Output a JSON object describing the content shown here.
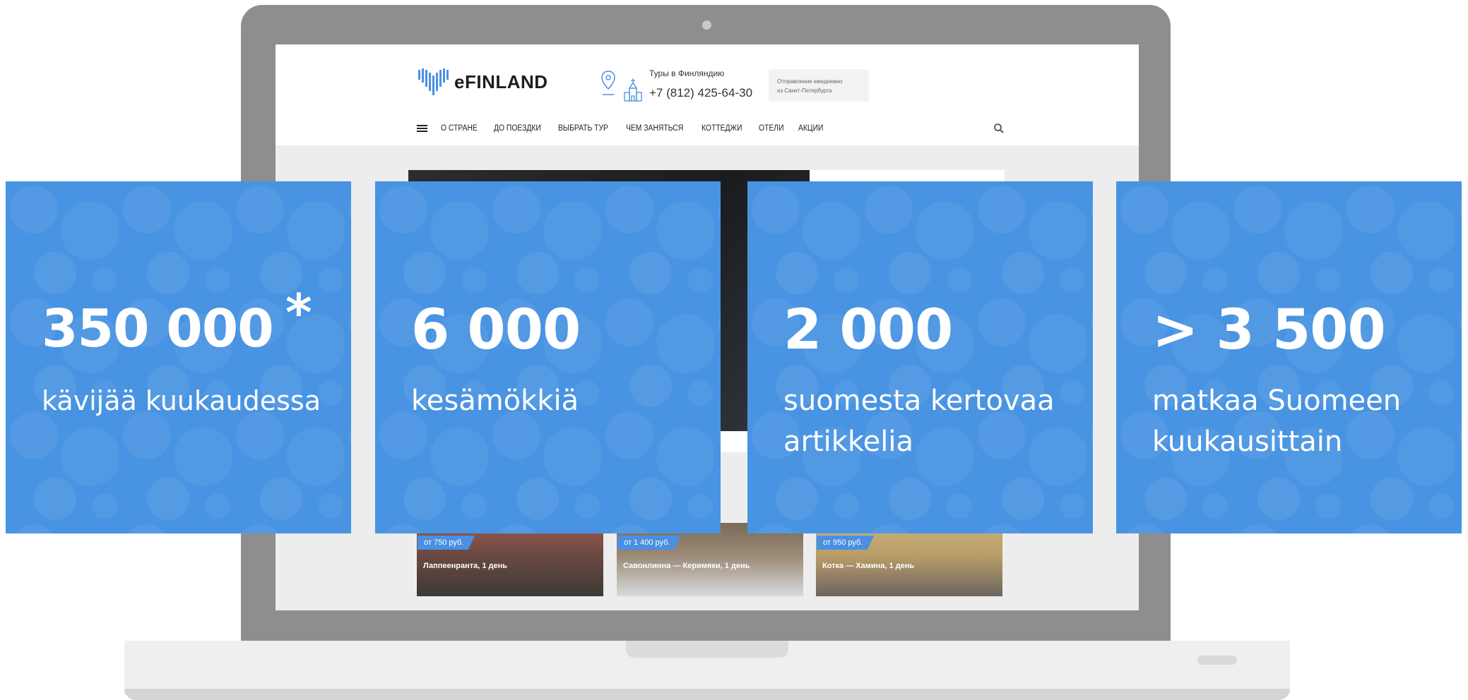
{
  "site": {
    "brand": "eFINLAND",
    "tours_label": "Туры в Финляндию",
    "phone": "+7 (812) 425-64-30",
    "departure_line1": "Отправление ежедневно",
    "departure_line2": "из Санкт-Петербурга",
    "nav": [
      "О СТРАНЕ",
      "ДО ПОЕЗДКИ",
      "ВЫБРАТЬ ТУР",
      "ЧЕМ ЗАНЯТЬСЯ",
      "КОТТЕДЖИ",
      "ОТЕЛИ",
      "АКЦИИ"
    ],
    "tours": [
      {
        "price": "от 750 руб.",
        "title": "Лаппеенранта, 1 день"
      },
      {
        "price": "от 1 400 руб.",
        "title": "Савонлинна — Керимяки, 1 день"
      },
      {
        "price": "от 950 руб.",
        "title": "Котка — Хамина, 1 день"
      }
    ]
  },
  "stats": [
    {
      "value": "350 000",
      "note": "*",
      "label_lines": [
        "kävijää kuukaudessa"
      ]
    },
    {
      "value": "6 000",
      "label_lines": [
        "kesämökkiä"
      ]
    },
    {
      "value": "2 000",
      "label_lines": [
        "suomesta kertovaa",
        "artikkelia"
      ]
    },
    {
      "value": "> 3 500",
      "label_lines": [
        "matkaa Suomeen",
        "kuukausittain"
      ]
    }
  ],
  "colors": {
    "tile_blue": "#4893e2",
    "laptop_lid": "#8f8e8f",
    "price_badge": "#4a90e2"
  },
  "icons": [
    "heart-logo-icon",
    "map-pin-icon",
    "church-icon",
    "hamburger-icon",
    "search-icon"
  ]
}
